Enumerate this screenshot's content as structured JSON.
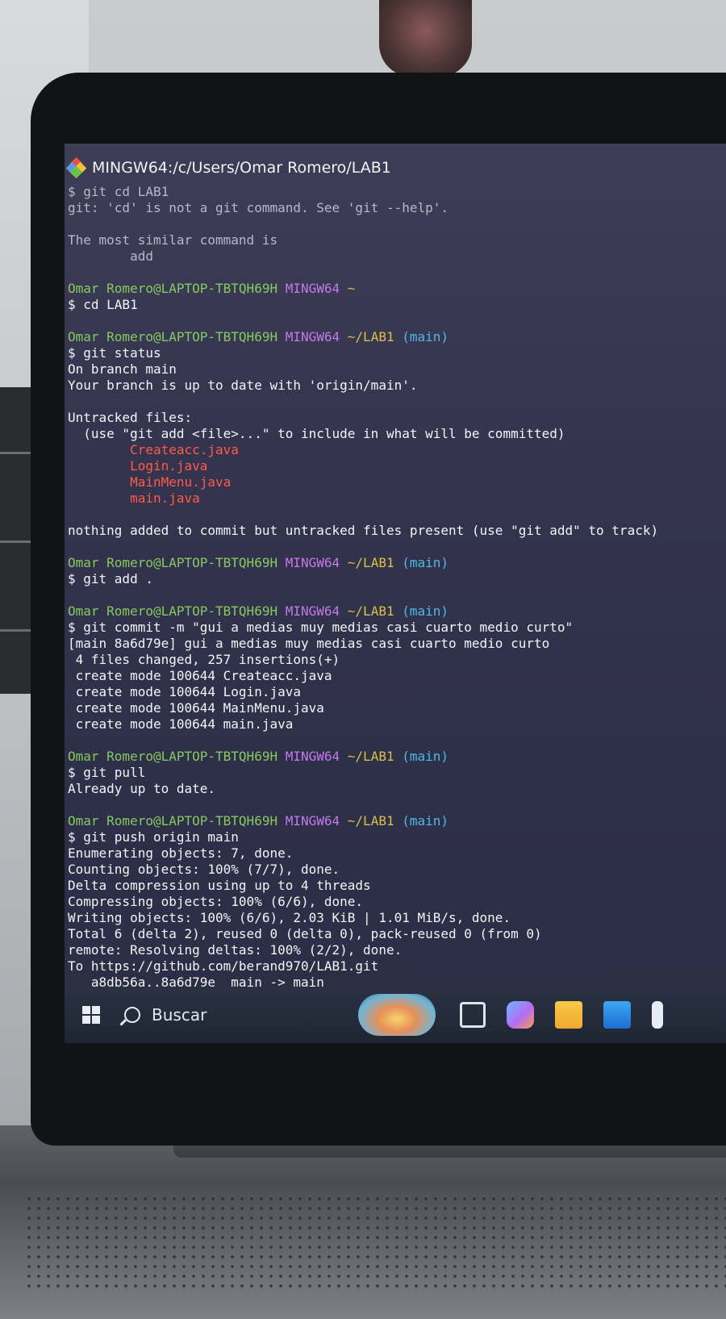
{
  "window": {
    "title": "MINGW64:/c/Users/Omar Romero/LAB1"
  },
  "terminal": {
    "lines": [
      {
        "segments": [
          {
            "text": "$ git cd LAB1",
            "style": "dim"
          }
        ]
      },
      {
        "segments": [
          {
            "text": "git: 'cd' is not a git command. See 'git --help'.",
            "style": "dim"
          }
        ]
      },
      {
        "segments": []
      },
      {
        "segments": [
          {
            "text": "The most similar command is",
            "style": "dim"
          }
        ]
      },
      {
        "segments": [
          {
            "text": "        add",
            "style": "dim"
          }
        ]
      },
      {
        "segments": []
      },
      {
        "segments": [
          {
            "text": "Omar Romero@LAPTOP-TBTQH69H ",
            "style": "green"
          },
          {
            "text": "MINGW64",
            "style": "purple"
          },
          {
            "text": " ~",
            "style": "yellow"
          }
        ]
      },
      {
        "segments": [
          {
            "text": "$ cd LAB1",
            "style": "white"
          }
        ]
      },
      {
        "segments": []
      },
      {
        "segments": [
          {
            "text": "Omar Romero@LAPTOP-TBTQH69H ",
            "style": "green"
          },
          {
            "text": "MINGW64",
            "style": "purple"
          },
          {
            "text": " ~/LAB1",
            "style": "yellow"
          },
          {
            "text": " (main)",
            "style": "cyan"
          }
        ]
      },
      {
        "segments": [
          {
            "text": "$ git status",
            "style": "white"
          }
        ]
      },
      {
        "segments": [
          {
            "text": "On branch main",
            "style": "white"
          }
        ]
      },
      {
        "segments": [
          {
            "text": "Your branch is up to date with 'origin/main'.",
            "style": "white"
          }
        ]
      },
      {
        "segments": []
      },
      {
        "segments": [
          {
            "text": "Untracked files:",
            "style": "white"
          }
        ]
      },
      {
        "segments": [
          {
            "text": "  (use \"git add <file>...\" to include in what will be committed)",
            "style": "white"
          }
        ]
      },
      {
        "segments": [
          {
            "text": "        Createacc.java",
            "style": "red"
          }
        ]
      },
      {
        "segments": [
          {
            "text": "        Login.java",
            "style": "red"
          }
        ]
      },
      {
        "segments": [
          {
            "text": "        MainMenu.java",
            "style": "red"
          }
        ]
      },
      {
        "segments": [
          {
            "text": "        main.java",
            "style": "red"
          }
        ]
      },
      {
        "segments": []
      },
      {
        "segments": [
          {
            "text": "nothing added to commit but untracked files present (use \"git add\" to track)",
            "style": "white"
          }
        ]
      },
      {
        "segments": []
      },
      {
        "segments": [
          {
            "text": "Omar Romero@LAPTOP-TBTQH69H ",
            "style": "green"
          },
          {
            "text": "MINGW64",
            "style": "purple"
          },
          {
            "text": " ~/LAB1",
            "style": "yellow"
          },
          {
            "text": " (main)",
            "style": "cyan"
          }
        ]
      },
      {
        "segments": [
          {
            "text": "$ git add .",
            "style": "white"
          }
        ]
      },
      {
        "segments": []
      },
      {
        "segments": [
          {
            "text": "Omar Romero@LAPTOP-TBTQH69H ",
            "style": "green"
          },
          {
            "text": "MINGW64",
            "style": "purple"
          },
          {
            "text": " ~/LAB1",
            "style": "yellow"
          },
          {
            "text": " (main)",
            "style": "cyan"
          }
        ]
      },
      {
        "segments": [
          {
            "text": "$ git commit -m \"gui a medias muy medias casi cuarto medio curto\"",
            "style": "white"
          }
        ]
      },
      {
        "segments": [
          {
            "text": "[main 8a6d79e] gui a medias muy medias casi cuarto medio curto",
            "style": "white"
          }
        ]
      },
      {
        "segments": [
          {
            "text": " 4 files changed, 257 insertions(+)",
            "style": "white"
          }
        ]
      },
      {
        "segments": [
          {
            "text": " create mode 100644 Createacc.java",
            "style": "white"
          }
        ]
      },
      {
        "segments": [
          {
            "text": " create mode 100644 Login.java",
            "style": "white"
          }
        ]
      },
      {
        "segments": [
          {
            "text": " create mode 100644 MainMenu.java",
            "style": "white"
          }
        ]
      },
      {
        "segments": [
          {
            "text": " create mode 100644 main.java",
            "style": "white"
          }
        ]
      },
      {
        "segments": []
      },
      {
        "segments": [
          {
            "text": "Omar Romero@LAPTOP-TBTQH69H ",
            "style": "green"
          },
          {
            "text": "MINGW64",
            "style": "purple"
          },
          {
            "text": " ~/LAB1",
            "style": "yellow"
          },
          {
            "text": " (main)",
            "style": "cyan"
          }
        ]
      },
      {
        "segments": [
          {
            "text": "$ git pull",
            "style": "white"
          }
        ]
      },
      {
        "segments": [
          {
            "text": "Already up to date.",
            "style": "white"
          }
        ]
      },
      {
        "segments": []
      },
      {
        "segments": [
          {
            "text": "Omar Romero@LAPTOP-TBTQH69H ",
            "style": "green"
          },
          {
            "text": "MINGW64",
            "style": "purple"
          },
          {
            "text": " ~/LAB1",
            "style": "yellow"
          },
          {
            "text": " (main)",
            "style": "cyan"
          }
        ]
      },
      {
        "segments": [
          {
            "text": "$ git push origin main",
            "style": "white"
          }
        ]
      },
      {
        "segments": [
          {
            "text": "Enumerating objects: 7, done.",
            "style": "white"
          }
        ]
      },
      {
        "segments": [
          {
            "text": "Counting objects: 100% (7/7), done.",
            "style": "white"
          }
        ]
      },
      {
        "segments": [
          {
            "text": "Delta compression using up to 4 threads",
            "style": "white"
          }
        ]
      },
      {
        "segments": [
          {
            "text": "Compressing objects: 100% (6/6), done.",
            "style": "white"
          }
        ]
      },
      {
        "segments": [
          {
            "text": "Writing objects: 100% (6/6), 2.03 KiB | 1.01 MiB/s, done.",
            "style": "white"
          }
        ]
      },
      {
        "segments": [
          {
            "text": "Total 6 (delta 2), reused 0 (delta 0), pack-reused 0 (from 0)",
            "style": "white"
          }
        ]
      },
      {
        "segments": [
          {
            "text": "remote: Resolving deltas: 100% (2/2), done.",
            "style": "white"
          }
        ]
      },
      {
        "segments": [
          {
            "text": "To https://github.com/berand970/LAB1.git",
            "style": "white"
          }
        ]
      },
      {
        "segments": [
          {
            "text": "   a8db56a..8a6d79e  main -> main",
            "style": "white"
          }
        ]
      }
    ]
  },
  "taskbar": {
    "search_label": "Buscar",
    "icons": [
      "windows-start-icon",
      "search-icon",
      "widgets-icon",
      "task-view-icon",
      "copilot-icon",
      "file-explorer-icon",
      "mail-icon",
      "store-icon"
    ]
  },
  "colors": {
    "prompt_user": "#86c95f",
    "prompt_system": "#c27ae6",
    "prompt_path": "#d8c247",
    "prompt_branch": "#4fb9e4",
    "untracked_file": "#ff5a4a",
    "terminal_background": "#34344e"
  }
}
